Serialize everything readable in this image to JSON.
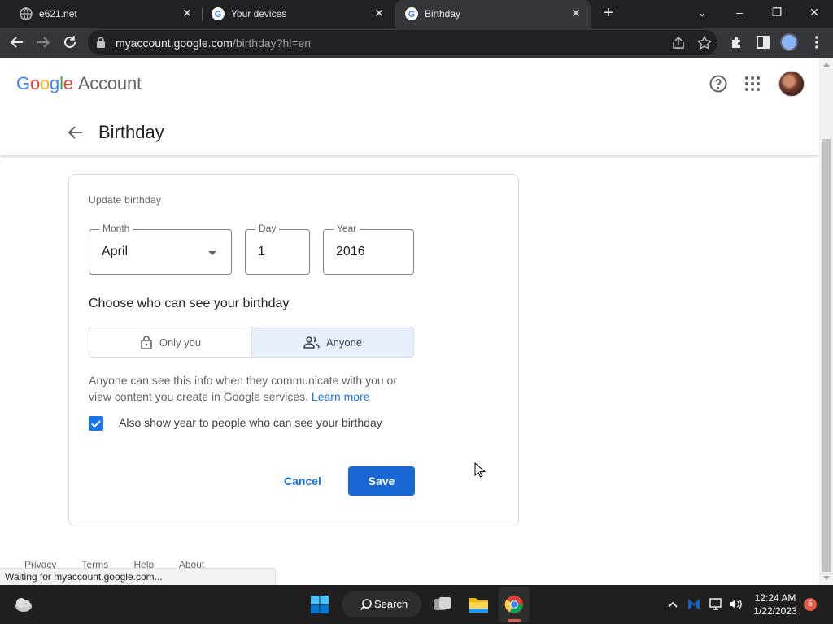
{
  "browser": {
    "tabs": [
      {
        "title": "e621.net",
        "active": false
      },
      {
        "title": "Your devices",
        "active": false
      },
      {
        "title": "Birthday",
        "active": true
      }
    ],
    "url_host": "myaccount.google.com",
    "url_path": "/birthday?hl=en",
    "status_text": "Waiting for myaccount.google.com..."
  },
  "header": {
    "logo_google": "Google",
    "logo_account": "Account",
    "page_title": "Birthday"
  },
  "form": {
    "section_label": "Update birthday",
    "month": {
      "label": "Month",
      "value": "April"
    },
    "day": {
      "label": "Day",
      "value": "1"
    },
    "year": {
      "label": "Year",
      "value": "2016"
    },
    "visibility_title": "Choose who can see your birthday",
    "visibility_options": [
      {
        "label": "Only you",
        "selected": false
      },
      {
        "label": "Anyone",
        "selected": true
      }
    ],
    "description": "Anyone can see this info when they communicate with you or view content you create in Google services.",
    "learn_more": "Learn more",
    "show_year_label": "Also show year to people who can see your birthday",
    "show_year_checked": true,
    "cancel_label": "Cancel",
    "save_label": "Save"
  },
  "footer": {
    "links": [
      "Privacy",
      "Terms",
      "Help",
      "About"
    ]
  },
  "taskbar": {
    "search_label": "Search",
    "time": "12:24 AM",
    "date": "1/22/2023",
    "notification_count": "5"
  },
  "colors": {
    "accent": "#1a73e8",
    "save_button": "#1967d2",
    "selected_segment": "#e8f0fe",
    "chrome_dark": "#202124",
    "chrome_toolbar": "#35363a"
  }
}
